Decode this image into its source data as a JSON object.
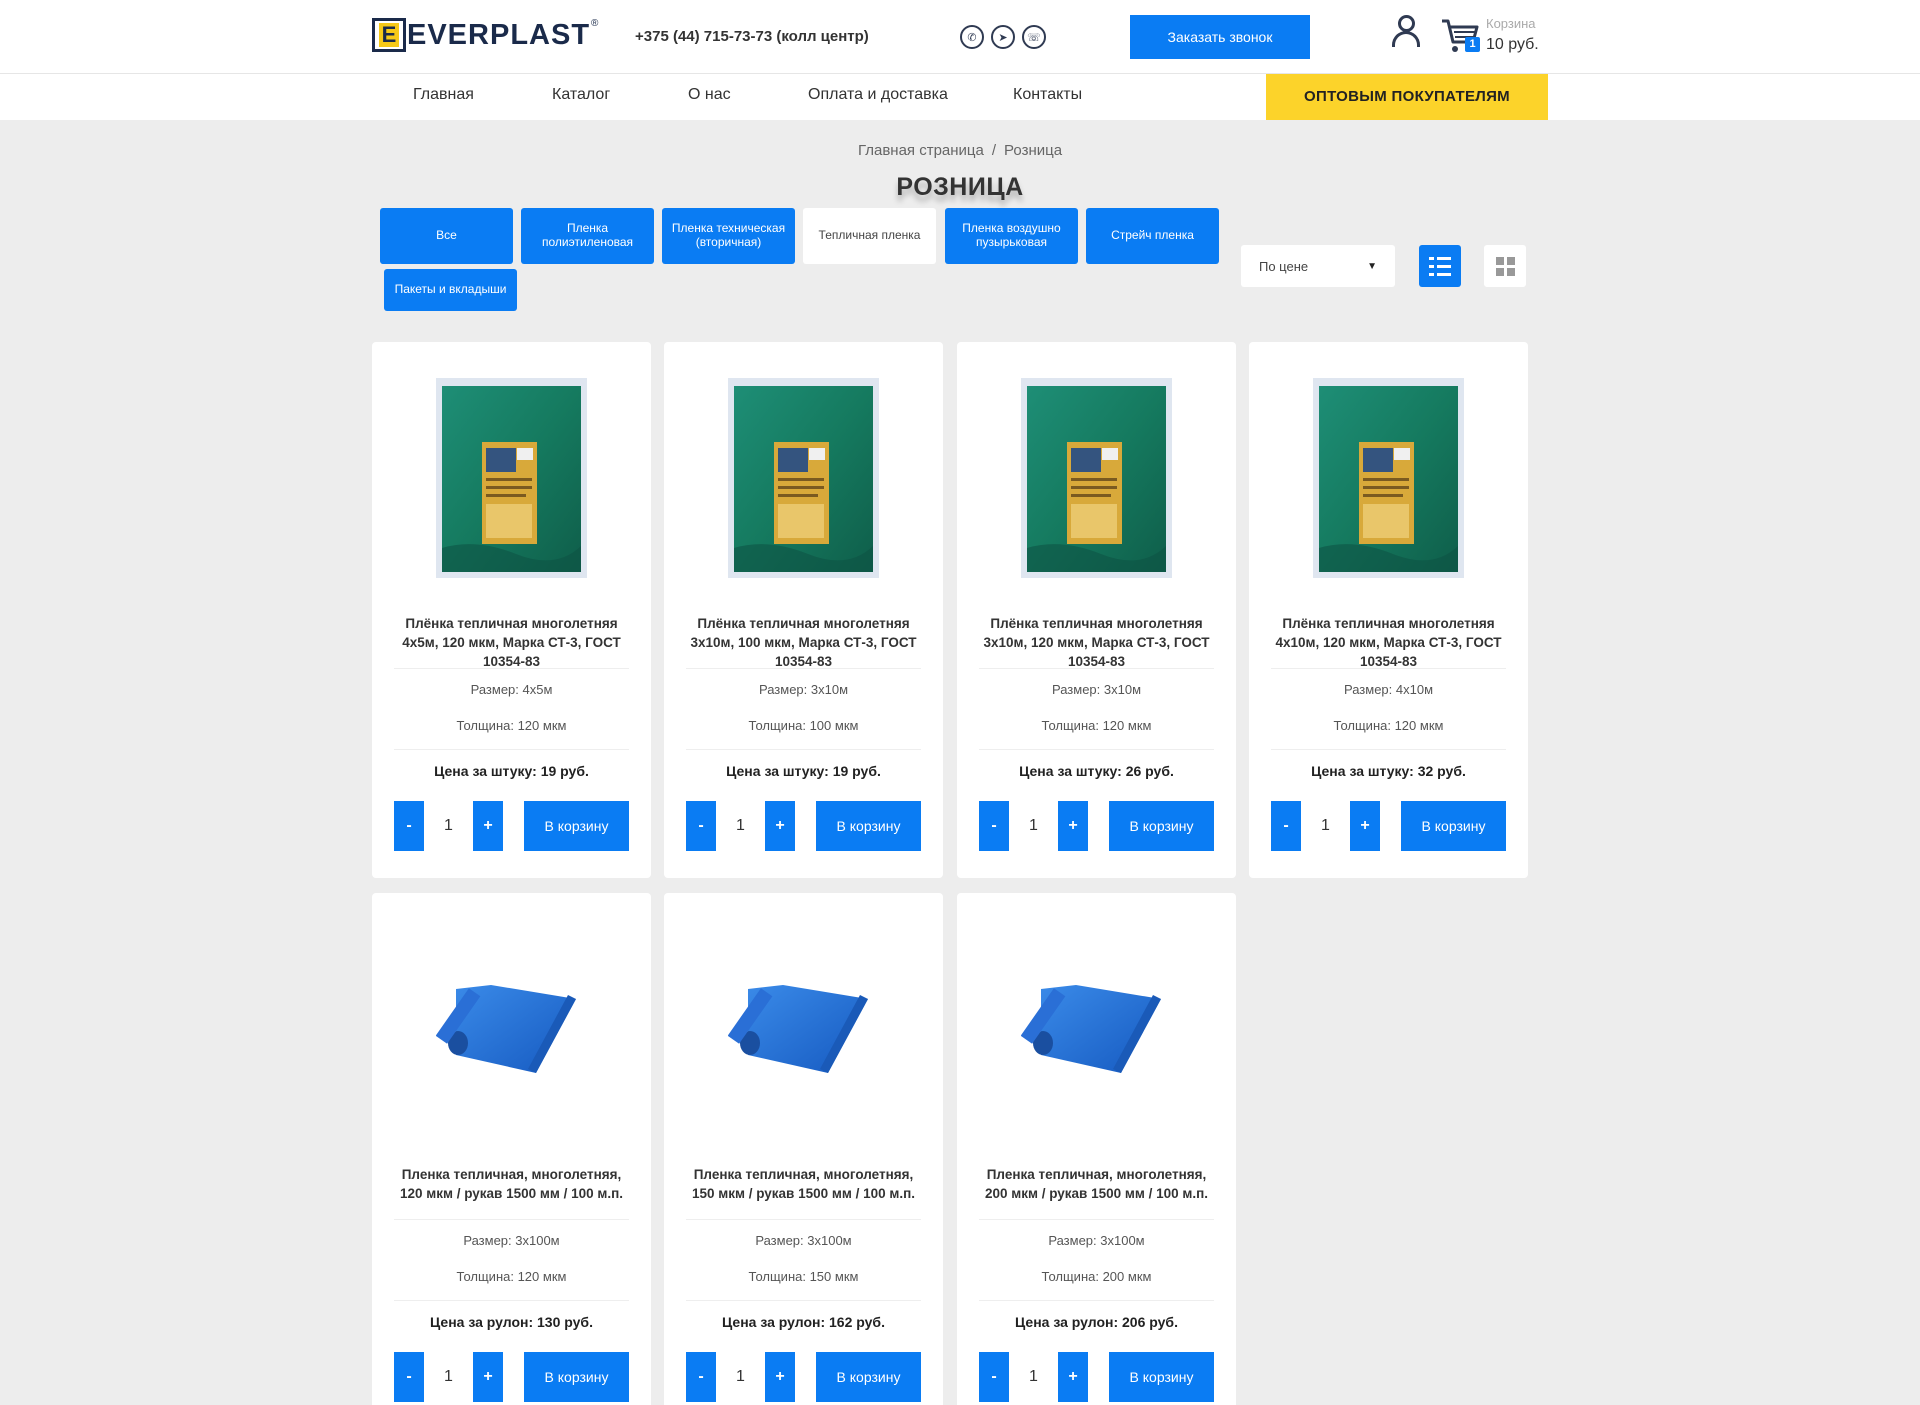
{
  "header": {
    "logo_text": "EVERPLAST",
    "logo_letter": "E",
    "logo_reg": "®",
    "phone": "+375 (44) 715-73-73 (колл центр)",
    "messengers": [
      "whatsapp-icon",
      "telegram-icon",
      "viber-icon"
    ],
    "callback_label": "Заказать звонок",
    "cart_label": "Корзина",
    "cart_sum": "10 руб.",
    "cart_count": "1"
  },
  "nav": {
    "items": [
      "Главная",
      "Каталог",
      "О нас",
      "Оплата и доставка",
      "Контакты"
    ],
    "wholesale_label": "ОПТОВЫМ ПОКУПАТЕЛЯМ"
  },
  "breadcrumbs": [
    "Главная страница",
    "Розница"
  ],
  "page_title": "РОЗНИЦА",
  "filters": {
    "categories": [
      {
        "label": "Все",
        "active": false
      },
      {
        "label": "Пленка полиэтиленовая",
        "active": false
      },
      {
        "label": "Пленка техническая (вторичная)",
        "active": false
      },
      {
        "label": "Тепличная пленка",
        "active": true
      },
      {
        "label": "Пленка воздушно пузырьковая",
        "active": false
      },
      {
        "label": "Стрейч пленка",
        "active": false
      },
      {
        "label": "Пакеты и вкладыши",
        "active": false
      }
    ],
    "sort_value": "По цене",
    "view_mode": "list"
  },
  "products": [
    {
      "title": "Плёнка тепличная многолетняя 4х5м, 120 мкм, Марка СТ-3, ГОСТ 10354-83",
      "size": "Размер: 4х5м",
      "thickness": "Толщина: 120 мкм",
      "price": "Цена за штуку: 19 руб.",
      "qty": "1",
      "cart_label": "В корзину",
      "image": "green-package"
    },
    {
      "title": "Плёнка тепличная многолетняя 3х10м, 100 мкм, Марка СТ-3, ГОСТ 10354-83",
      "size": "Размер: 3х10м",
      "thickness": "Толщина: 100 мкм",
      "price": "Цена за штуку: 19 руб.",
      "qty": "1",
      "cart_label": "В корзину",
      "image": "green-package"
    },
    {
      "title": "Плёнка тепличная многолетняя 3х10м, 120 мкм, Марка СТ-3, ГОСТ 10354-83",
      "size": "Размер: 3х10м",
      "thickness": "Толщина: 120 мкм",
      "price": "Цена за штуку: 26 руб.",
      "qty": "1",
      "cart_label": "В корзину",
      "image": "green-package"
    },
    {
      "title": "Плёнка тепличная многолетняя 4х10м, 120 мкм, Марка СТ-3, ГОСТ 10354-83",
      "size": "Размер: 4х10м",
      "thickness": "Толщина: 120 мкм",
      "price": "Цена за штуку: 32 руб.",
      "qty": "1",
      "cart_label": "В корзину",
      "image": "green-package"
    },
    {
      "title": "Пленка тепличная, многолетняя, 120 мкм / рукав 1500 мм / 100 м.п.",
      "size": "Размер: 3х100м",
      "thickness": "Толщина: 120 мкм",
      "price": "Цена за рулон: 130 руб.",
      "qty": "1",
      "cart_label": "В корзину",
      "image": "blue-roll"
    },
    {
      "title": "Пленка тепличная, многолетняя, 150 мкм / рукав 1500 мм / 100 м.п.",
      "size": "Размер: 3х100м",
      "thickness": "Толщина: 150 мкм",
      "price": "Цена за рулон: 162 руб.",
      "qty": "1",
      "cart_label": "В корзину",
      "image": "blue-roll"
    },
    {
      "title": "Пленка тепличная, многолетняя, 200 мкм / рукав 1500 мм / 100 м.п.",
      "size": "Размер: 3х100м",
      "thickness": "Толщина: 200 мкм",
      "price": "Цена за рулон: 206 руб.",
      "qty": "1",
      "cart_label": "В корзину",
      "image": "blue-roll"
    }
  ],
  "qty_minus": "-",
  "qty_plus": "+",
  "colors": {
    "accent": "#0a7cf3",
    "wholesale": "#fcd32a",
    "background": "#ededed",
    "dark": "#1a2a4a"
  }
}
